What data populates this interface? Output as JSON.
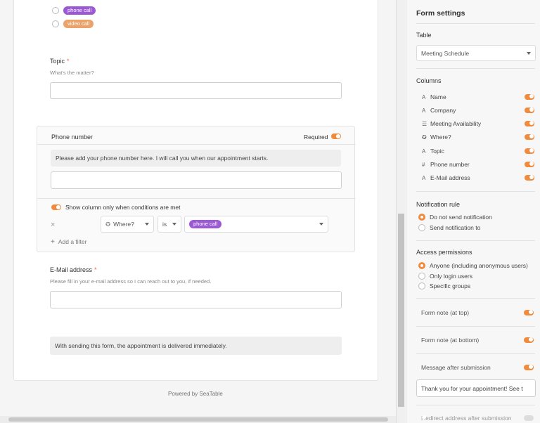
{
  "form": {
    "options": [
      {
        "label": "phone call",
        "color": "#9b59d6"
      },
      {
        "label": "video call",
        "color": "#eba36b"
      }
    ],
    "topic": {
      "label": "Topic",
      "required_mark": "*",
      "help": "What's the matter?",
      "value": ""
    },
    "phone": {
      "label": "Phone number",
      "required_label": "Required",
      "note": "Please add your phone number here. I will call you when our appointment starts.",
      "value": "",
      "condition_label": "Show column only when conditions are met",
      "filter": {
        "remove": "×",
        "column": "Where?",
        "operator": "is",
        "value": "phone call",
        "value_color": "#9b59d6"
      },
      "add_filter": "Add a filter",
      "add_icon": "+"
    },
    "email": {
      "label": "E-Mail address",
      "required_mark": "*",
      "help": "Please fill in your e-mail address so I can reach out to you, if needed.",
      "value": ""
    },
    "bottom_note": "With sending this form, the appointment is delivered immediately.",
    "powered_by": "Powered by SeaTable"
  },
  "settings": {
    "title": "Form settings",
    "table_label": "Table",
    "table_value": "Meeting Schedule",
    "columns_label": "Columns",
    "columns": [
      {
        "icon": "A",
        "label": "Name",
        "on": true
      },
      {
        "icon": "A",
        "label": "Company",
        "on": true
      },
      {
        "icon": "☰",
        "label": "Meeting Availability",
        "on": true
      },
      {
        "icon": "✪",
        "label": "Where?",
        "on": true
      },
      {
        "icon": "A",
        "label": "Topic",
        "on": true
      },
      {
        "icon": "#",
        "label": "Phone number",
        "on": true
      },
      {
        "icon": "A",
        "label": "E-Mail address",
        "on": true
      }
    ],
    "notification_label": "Notification rule",
    "notification_options": [
      {
        "label": "Do not send notification",
        "selected": true
      },
      {
        "label": "Send notification to",
        "selected": false
      }
    ],
    "access_label": "Access permissions",
    "access_options": [
      {
        "label": "Anyone (including anonymous users)",
        "selected": true
      },
      {
        "label": "Only login users",
        "selected": false
      },
      {
        "label": "Specific groups",
        "selected": false
      }
    ],
    "note_top": "Form note (at top)",
    "note_bottom": "Form note (at bottom)",
    "message_after": "Message after submission",
    "message_value": "Thank you for your appointment! See t",
    "redirect": "Redirect address after submission"
  },
  "colors": {
    "accent": "#f08a3c"
  }
}
